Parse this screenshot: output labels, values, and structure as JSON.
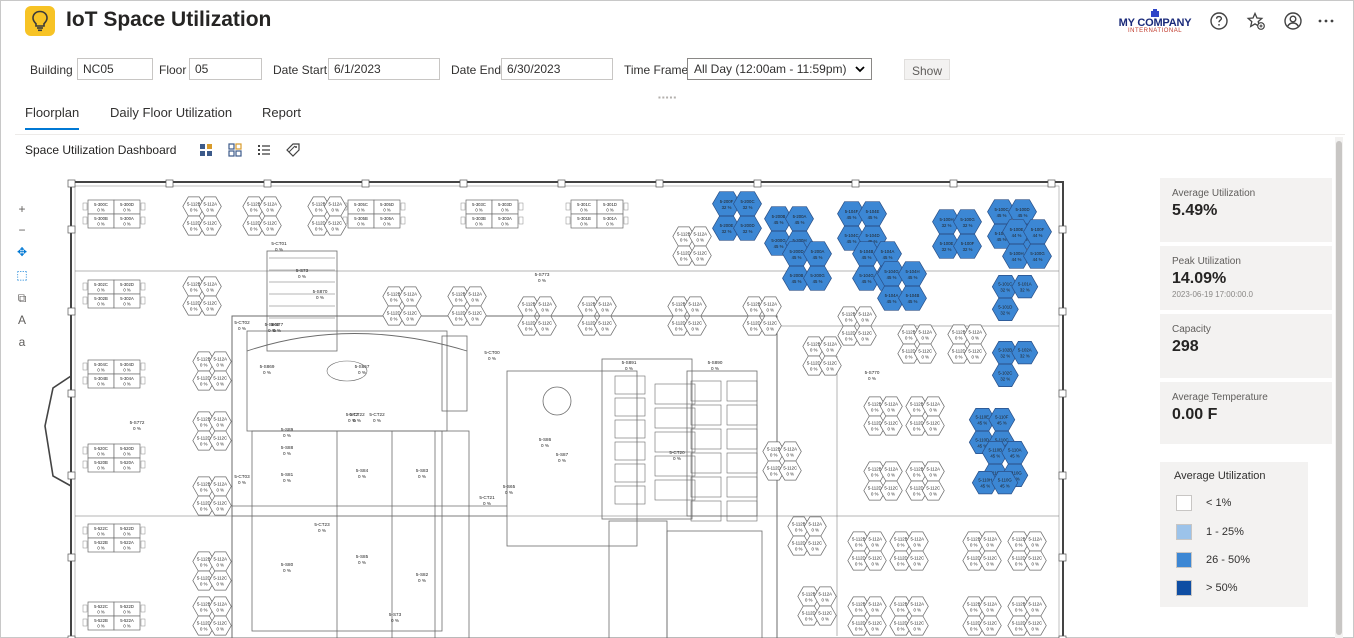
{
  "app": {
    "title": "IoT Space Utilization",
    "icon": "lightbulb-icon"
  },
  "company": {
    "name": "MY COMPANY",
    "sub": "INTERNATIONAL"
  },
  "header_icons": [
    "help-icon",
    "favorite-icon",
    "account-icon",
    "more-icon"
  ],
  "filters": {
    "building_label": "Building",
    "building_value": "NC05",
    "floor_label": "Floor",
    "floor_value": "05",
    "date_start_label": "Date Start",
    "date_start_value": "6/1/2023",
    "date_end_label": "Date End",
    "date_end_value": "6/30/2023",
    "time_frame_label": "Time Frame",
    "time_frame_value": "All Day (12:00am - 11:59pm)",
    "show_label": "Show"
  },
  "tabs": [
    {
      "label": "Floorplan",
      "active": true
    },
    {
      "label": "Daily Floor Utilization",
      "active": false
    },
    {
      "label": "Report",
      "active": false
    }
  ],
  "dashboard": {
    "title": "Space Utilization Dashboard"
  },
  "view_icons": [
    "grid-large-icon",
    "grid-small-icon",
    "list-icon",
    "tag-icon"
  ],
  "tools": [
    {
      "name": "zoom-in-icon",
      "glyph": "+"
    },
    {
      "name": "zoom-out-icon",
      "glyph": "−"
    },
    {
      "name": "locate-icon",
      "glyph": "✥"
    },
    {
      "name": "select-area-icon",
      "glyph": "⬚"
    },
    {
      "name": "copy-icon",
      "glyph": "⧉"
    },
    {
      "name": "text-large-icon",
      "glyph": "A"
    },
    {
      "name": "text-small-icon",
      "glyph": "a"
    }
  ],
  "stats": [
    {
      "label": "Average Utilization",
      "value": "5.49%",
      "sub": ""
    },
    {
      "label": "Peak Utilization",
      "value": "14.09%",
      "sub": "2023-06-19 17:00:00.0"
    },
    {
      "label": "Capacity",
      "value": "298",
      "sub": ""
    },
    {
      "label": "Average Temperature",
      "value": "0.00 F",
      "sub": ""
    }
  ],
  "legend": {
    "title": "Average Utilization",
    "items": [
      {
        "label": "< 1%",
        "color": "#ffffff"
      },
      {
        "label": "1 - 25%",
        "color": "#9cc3ea"
      },
      {
        "label": "26 - 50%",
        "color": "#3c87d4"
      },
      {
        "label": "> 50%",
        "color": "#0f4ea3"
      }
    ]
  },
  "floor_labels": {
    "w_top": [
      "5-300C",
      "5-300D",
      "5-300B",
      "5-300A"
    ],
    "w_mid": [
      "5-302C",
      "5-302D",
      "5-302B",
      "5-302A"
    ],
    "w_low": [
      "5-304C",
      "5-304D",
      "5-304B",
      "5-304A"
    ],
    "w_520": [
      "5-520C",
      "5-520D",
      "5-520B",
      "5-520A"
    ],
    "w_522": [
      "5-522C",
      "5-522D",
      "5-522B",
      "5-522A"
    ],
    "top_301": [
      "5-301C",
      "5-301D",
      "5-301B",
      "5-301A"
    ],
    "top_303": [
      "5-303C",
      "5-303D",
      "5-303B",
      "5-303A"
    ],
    "top_305": [
      "5-305C",
      "5-305D",
      "5-305B",
      "5-305A"
    ],
    "zero": "0 %",
    "pct32": "32 %",
    "pct45": "45 %",
    "pct44": "44 %",
    "blue_a": [
      "5-200F",
      "5-200C",
      "5-200E",
      "5-200D",
      "5-200B",
      "5-200A",
      "5-200G",
      "5-200H"
    ],
    "blue_b": [
      "5-104F",
      "5-104E",
      "5-104C",
      "5-104D",
      "5-104B",
      "5-104A",
      "5-104G",
      "5-104H"
    ],
    "blue_c": [
      "5-100H",
      "5-100G",
      "5-100E",
      "5-100F",
      "5-100C",
      "5-100D",
      "5-100B",
      "5-100A"
    ],
    "blue_d": [
      "5-101C",
      "5-101A",
      "5-101D"
    ],
    "blue_e": [
      "5-102B",
      "5-102A",
      "5-102C"
    ],
    "blue_f": [
      "5-110E",
      "5-110F",
      "5-110D",
      "5-110C",
      "5-110B",
      "5-110A",
      "5-110H",
      "5-110G"
    ],
    "rooms": [
      "5-S73",
      "5-S870",
      "5-S72",
      "5-S86",
      "5-S87",
      "5-S77",
      "5-CT22",
      "5-S89",
      "5-S88",
      "5-S84",
      "5-S85",
      "5-S83",
      "5-S82",
      "5-S81",
      "5-S80",
      "5-S73",
      "5-S65"
    ],
    "room_names": [
      "5-S773",
      "5-S772",
      "5-S770",
      "5-CT01",
      "5-CT02",
      "5-CT22",
      "5-CT23",
      "5-CT21",
      "5-CT20",
      "5-CT03",
      "5-CT00",
      "5-S891",
      "5-S890",
      "5-S869",
      "5-S868",
      "5-S867"
    ]
  }
}
